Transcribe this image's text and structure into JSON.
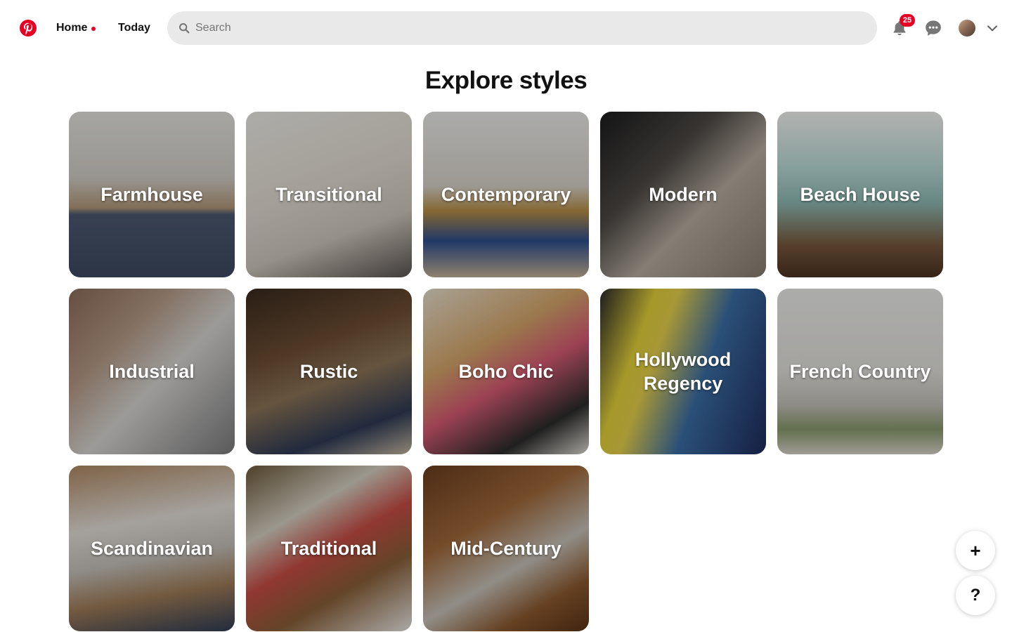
{
  "header": {
    "logo_icon": "pinterest-logo-icon",
    "brand_color": "#e60023",
    "nav": [
      {
        "label": "Home",
        "active": true
      },
      {
        "label": "Today",
        "active": false
      }
    ],
    "search": {
      "placeholder": "Search",
      "value": ""
    },
    "notifications": {
      "icon": "bell-icon",
      "count": "25"
    },
    "messages": {
      "icon": "chat-icon"
    },
    "account": {
      "avatar": "avatar",
      "menu_icon": "chevron-down-icon"
    }
  },
  "main": {
    "title": "Explore styles",
    "styles": [
      {
        "label": "Farmhouse"
      },
      {
        "label": "Transitional"
      },
      {
        "label": "Contemporary"
      },
      {
        "label": "Modern"
      },
      {
        "label": "Beach House"
      },
      {
        "label": "Industrial"
      },
      {
        "label": "Rustic"
      },
      {
        "label": "Boho Chic"
      },
      {
        "label": "Hollywood Regency"
      },
      {
        "label": "French Country"
      },
      {
        "label": "Scandinavian"
      },
      {
        "label": "Traditional"
      },
      {
        "label": "Mid-Century"
      }
    ]
  },
  "floating": {
    "create_label": "+",
    "help_label": "?"
  }
}
